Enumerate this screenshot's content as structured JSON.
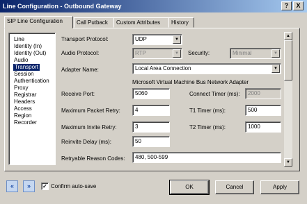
{
  "window": {
    "title": "Line Configuration - Outbound Gateway",
    "help_label": "?",
    "close_label": "X"
  },
  "tabs": [
    {
      "label": "SIP Line Configuration",
      "active": true
    },
    {
      "label": "Call Putback",
      "active": false
    },
    {
      "label": "Custom Attributes",
      "active": false
    },
    {
      "label": "History",
      "active": false
    }
  ],
  "categories": {
    "items": [
      "Line",
      "Identity (In)",
      "Identity (Out)",
      "Audio",
      "Transport",
      "Session",
      "Authentication",
      "Proxy",
      "Registrar",
      "Headers",
      "Access",
      "Region",
      "Recorder"
    ],
    "selected": "Transport"
  },
  "form": {
    "transport_protocol": {
      "label": "Transport Protocol:",
      "value": "UDP"
    },
    "audio_protocol": {
      "label": "Audio Protocol:",
      "value": "RTP"
    },
    "security": {
      "label": "Security:",
      "value": "Minimal"
    },
    "adapter_name": {
      "label": "Adapter Name:",
      "value": "Local Area Connection"
    },
    "adapter_description": "Microsoft Virtual Machine Bus Network Adapter",
    "receive_port": {
      "label": "Receive Port:",
      "value": "5060"
    },
    "connect_timer": {
      "label": "Connect Timer (ms):",
      "value": "2000"
    },
    "max_packet_retry": {
      "label": "Maximum Packet Retry:",
      "value": "4"
    },
    "t1_timer": {
      "label": "T1 Timer (ms):",
      "value": "500"
    },
    "max_invite_retry": {
      "label": "Maximum Invite Retry:",
      "value": "3"
    },
    "t2_timer": {
      "label": "T2 Timer (ms):",
      "value": "1000"
    },
    "reinvite_delay": {
      "label": "Reinvite Delay (ms):",
      "value": "50"
    },
    "retryable_reason_codes": {
      "label": "Retryable Reason Codes:",
      "value": "480, 500-599"
    }
  },
  "footer": {
    "prev_icon": "double-left-arrow",
    "next_icon": "double-right-arrow",
    "confirm_autosave_label": "Confirm auto-save",
    "confirm_autosave_checked": true,
    "ok_label": "OK",
    "cancel_label": "Cancel",
    "apply_label": "Apply"
  },
  "colors": {
    "title_start": "#0a246a",
    "title_end": "#a6caf0",
    "selection": "#0a246a",
    "nav_button": "#c5d7f0"
  }
}
